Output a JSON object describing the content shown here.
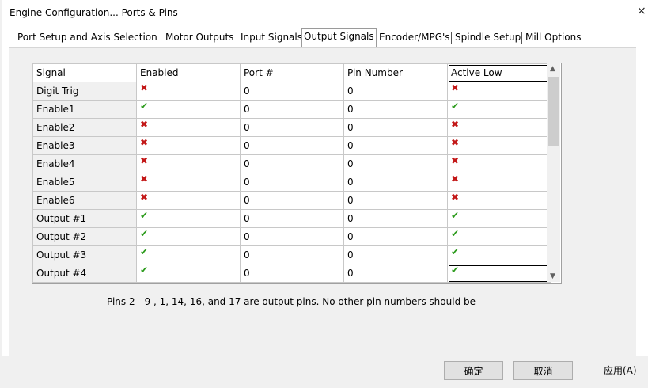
{
  "window": {
    "title": "Engine Configuration... Ports & Pins",
    "close_label": "×"
  },
  "tabs": [
    {
      "label": "Port Setup and Axis Selection"
    },
    {
      "label": "Motor Outputs"
    },
    {
      "label": "Input Signals"
    },
    {
      "label": "Output Signals"
    },
    {
      "label": "Encoder/MPG's"
    },
    {
      "label": "Spindle Setup"
    },
    {
      "label": "Mill Options"
    }
  ],
  "active_tab": "Output Signals",
  "table": {
    "columns": [
      "Signal",
      "Enabled",
      "Port #",
      "Pin Number",
      "Active Low"
    ],
    "rows": [
      {
        "signal": "Digit  Trig",
        "enabled": "no",
        "port": "0",
        "pin": "0",
        "active_low": "no"
      },
      {
        "signal": "Enable1",
        "enabled": "yes",
        "port": "0",
        "pin": "0",
        "active_low": "yes"
      },
      {
        "signal": "Enable2",
        "enabled": "no",
        "port": "0",
        "pin": "0",
        "active_low": "no"
      },
      {
        "signal": "Enable3",
        "enabled": "no",
        "port": "0",
        "pin": "0",
        "active_low": "no"
      },
      {
        "signal": "Enable4",
        "enabled": "no",
        "port": "0",
        "pin": "0",
        "active_low": "no"
      },
      {
        "signal": "Enable5",
        "enabled": "no",
        "port": "0",
        "pin": "0",
        "active_low": "no"
      },
      {
        "signal": "Enable6",
        "enabled": "no",
        "port": "0",
        "pin": "0",
        "active_low": "no"
      },
      {
        "signal": "Output #1",
        "enabled": "yes",
        "port": "0",
        "pin": "0",
        "active_low": "yes"
      },
      {
        "signal": "Output #2",
        "enabled": "yes",
        "port": "0",
        "pin": "0",
        "active_low": "yes"
      },
      {
        "signal": "Output #3",
        "enabled": "yes",
        "port": "0",
        "pin": "0",
        "active_low": "yes"
      },
      {
        "signal": "Output #4",
        "enabled": "yes",
        "port": "0",
        "pin": "0",
        "active_low": "yes"
      }
    ],
    "icons": {
      "yes": "green-check-icon",
      "no": "red-x-icon"
    },
    "colors": {
      "yes": "#2a9a1a",
      "no": "#c31818"
    }
  },
  "note": "Pins 2 - 9 , 1, 14, 16, and 17 are output pins. No  other pin numbers should be",
  "buttons": {
    "ok": "确定",
    "cancel": "取消",
    "apply": "应用(A)"
  }
}
